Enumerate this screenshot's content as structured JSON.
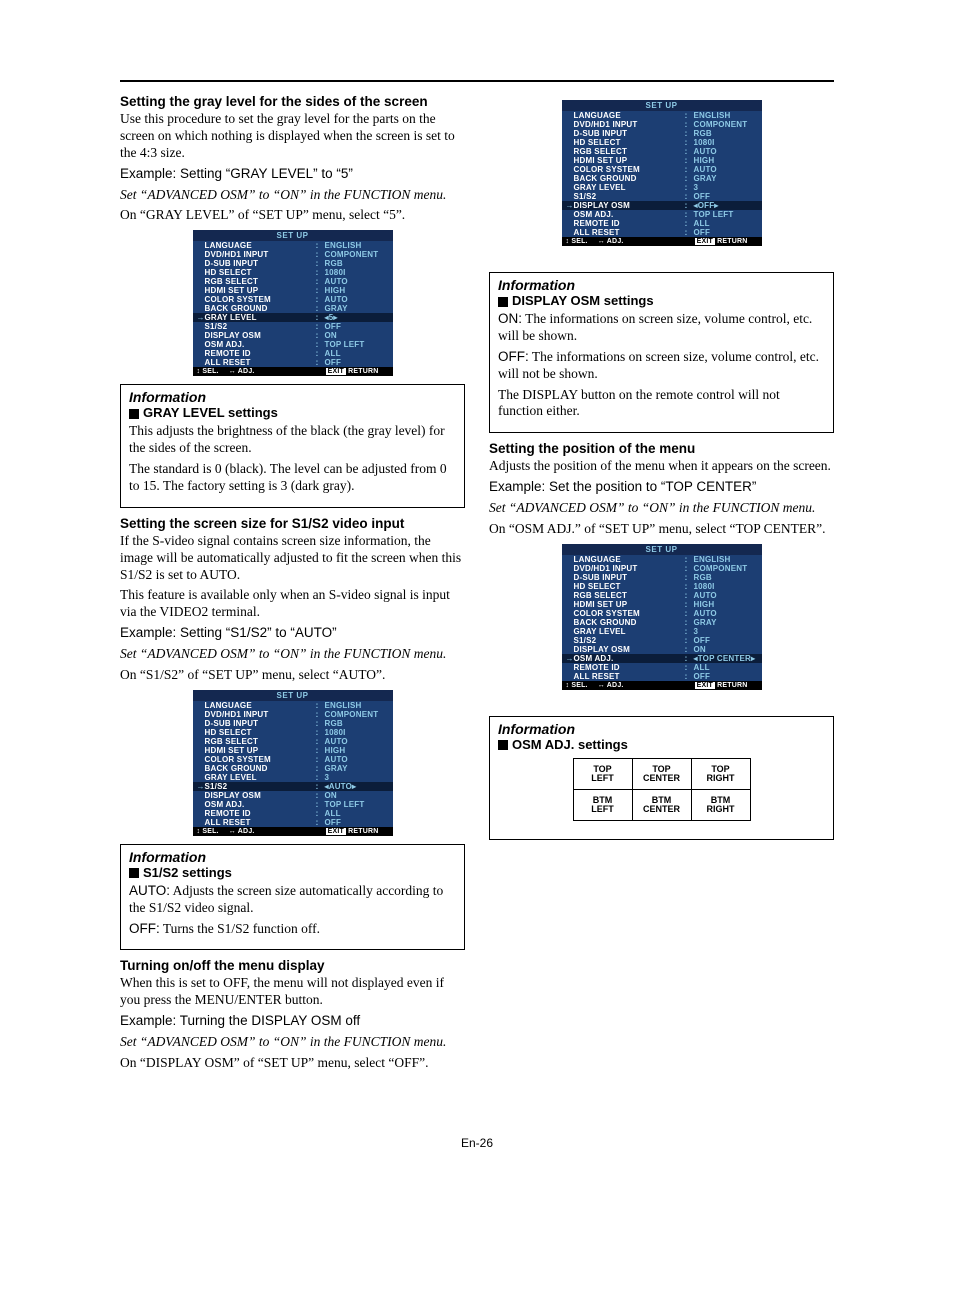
{
  "page_number": "En-26",
  "left": {
    "s1": {
      "title": "Setting the gray level for the sides of the screen",
      "p1": "Use this procedure to set the gray level for the parts on the screen on which nothing is displayed when the screen is set to the 4:3 size.",
      "ex": "Example: Setting “GRAY LEVEL” to “5”",
      "ital": "Set “ADVANCED OSM” to “ON” in the FUNCTION menu.",
      "p2": "On “GRAY LEVEL” of “SET UP” menu, select “5”."
    },
    "osd1": {
      "title": "SET UP",
      "rows": [
        {
          "l": "LANGUAGE",
          "v": "ENGLISH"
        },
        {
          "l": "DVD/HD1 INPUT",
          "v": "COMPONENT"
        },
        {
          "l": "D-SUB INPUT",
          "v": "RGB"
        },
        {
          "l": "HD SELECT",
          "v": "1080I"
        },
        {
          "l": "RGB SELECT",
          "v": "AUTO"
        },
        {
          "l": "HDMI SET UP",
          "v": "HIGH"
        },
        {
          "l": "COLOR SYSTEM",
          "v": "AUTO"
        },
        {
          "l": "BACK GROUND",
          "v": "GRAY"
        },
        {
          "l": "GRAY LEVEL",
          "v": "◂5▸",
          "sel": true
        },
        {
          "l": "S1/S2",
          "v": "OFF"
        },
        {
          "l": "DISPLAY OSM",
          "v": "ON"
        },
        {
          "l": "OSM ADJ.",
          "v": "TOP LEFT"
        },
        {
          "l": "REMOTE ID",
          "v": "ALL"
        },
        {
          "l": "ALL RESET",
          "v": "OFF"
        }
      ]
    },
    "info1": {
      "title": "Information",
      "sub": "GRAY LEVEL settings",
      "p1": "This adjusts the brightness of the black (the gray level) for the sides of the screen.",
      "p2": "The standard is 0 (black). The level can be adjusted from 0 to 15. The factory setting is 3 (dark gray)."
    },
    "s2": {
      "title": "Setting the screen size for S1/S2 video input",
      "p1": "If the S-video signal contains screen size information, the image will be automatically adjusted to fit the screen when this S1/S2 is set to AUTO.",
      "p2": "This feature is available only when an S-video signal is input via the VIDEO2 terminal.",
      "ex": "Example: Setting “S1/S2” to “AUTO”",
      "ital": "Set “ADVANCED OSM” to “ON” in the FUNCTION menu.",
      "p3": "On “S1/S2” of “SET UP” menu, select “AUTO”."
    },
    "osd2": {
      "title": "SET UP",
      "rows": [
        {
          "l": "LANGUAGE",
          "v": "ENGLISH"
        },
        {
          "l": "DVD/HD1 INPUT",
          "v": "COMPONENT"
        },
        {
          "l": "D-SUB INPUT",
          "v": "RGB"
        },
        {
          "l": "HD SELECT",
          "v": "1080I"
        },
        {
          "l": "RGB SELECT",
          "v": "AUTO"
        },
        {
          "l": "HDMI SET UP",
          "v": "HIGH"
        },
        {
          "l": "COLOR SYSTEM",
          "v": "AUTO"
        },
        {
          "l": "BACK GROUND",
          "v": "GRAY"
        },
        {
          "l": "GRAY LEVEL",
          "v": "3"
        },
        {
          "l": "S1/S2",
          "v": "◂AUTO▸",
          "sel": true
        },
        {
          "l": "DISPLAY OSM",
          "v": "ON"
        },
        {
          "l": "OSM ADJ.",
          "v": "TOP LEFT"
        },
        {
          "l": "REMOTE ID",
          "v": "ALL"
        },
        {
          "l": "ALL RESET",
          "v": "OFF"
        }
      ]
    },
    "info2": {
      "title": "Information",
      "sub": "S1/S2 settings",
      "auto_l": "AUTO:",
      "auto_t": " Adjusts the screen size automatically according to the S1/S2 video signal.",
      "off_l": "OFF:",
      "off_t": " Turns the S1/S2 function off."
    },
    "s3": {
      "title": "Turning on/off the menu display",
      "p1": "When this is set to OFF, the menu will not displayed even if you press the MENU/ENTER button.",
      "ex": "Example: Turning the DISPLAY OSM off",
      "ital": "Set “ADVANCED OSM” to “ON” in the FUNCTION menu.",
      "p2": "On “DISPLAY OSM” of “SET UP” menu, select “OFF”."
    }
  },
  "right": {
    "osd3": {
      "title": "SET UP",
      "rows": [
        {
          "l": "LANGUAGE",
          "v": "ENGLISH"
        },
        {
          "l": "DVD/HD1 INPUT",
          "v": "COMPONENT"
        },
        {
          "l": "D-SUB INPUT",
          "v": "RGB"
        },
        {
          "l": "HD SELECT",
          "v": "1080I"
        },
        {
          "l": "RGB SELECT",
          "v": "AUTO"
        },
        {
          "l": "HDMI SET UP",
          "v": "HIGH"
        },
        {
          "l": "COLOR SYSTEM",
          "v": "AUTO"
        },
        {
          "l": "BACK GROUND",
          "v": "GRAY"
        },
        {
          "l": "GRAY LEVEL",
          "v": "3"
        },
        {
          "l": "S1/S2",
          "v": "OFF"
        },
        {
          "l": "DISPLAY OSM",
          "v": "◂OFF▸",
          "sel": true
        },
        {
          "l": "OSM ADJ.",
          "v": "TOP LEFT"
        },
        {
          "l": "REMOTE ID",
          "v": "ALL"
        },
        {
          "l": "ALL RESET",
          "v": "OFF"
        }
      ]
    },
    "info3": {
      "title": "Information",
      "sub": "DISPLAY OSM settings",
      "on_l": "ON:",
      "on_t": " The informations on screen size, volume control, etc. will be shown.",
      "off_l": "OFF:",
      "off_t": " The informations on screen size, volume control, etc. will not be shown.",
      "p3": "The DISPLAY button on the remote control will not function either."
    },
    "s4": {
      "title": "Setting the position of the menu",
      "p1": "Adjusts the position of the menu when it appears on the screen.",
      "ex": "Example: Set the position to “TOP CENTER”",
      "ital": "Set “ADVANCED OSM” to “ON” in the FUNCTION menu.",
      "p2": "On “OSM ADJ.” of “SET UP” menu, select “TOP CENTER”."
    },
    "osd4": {
      "title": "SET UP",
      "rows": [
        {
          "l": "LANGUAGE",
          "v": "ENGLISH"
        },
        {
          "l": "DVD/HD1 INPUT",
          "v": "COMPONENT"
        },
        {
          "l": "D-SUB INPUT",
          "v": "RGB"
        },
        {
          "l": "HD SELECT",
          "v": "1080I"
        },
        {
          "l": "RGB SELECT",
          "v": "AUTO"
        },
        {
          "l": "HDMI SET UP",
          "v": "HIGH"
        },
        {
          "l": "COLOR SYSTEM",
          "v": "AUTO"
        },
        {
          "l": "BACK GROUND",
          "v": "GRAY"
        },
        {
          "l": "GRAY LEVEL",
          "v": "3"
        },
        {
          "l": "S1/S2",
          "v": "OFF"
        },
        {
          "l": "DISPLAY OSM",
          "v": "ON"
        },
        {
          "l": "OSM ADJ.",
          "v": "◂TOP CENTER▸",
          "sel": true
        },
        {
          "l": "REMOTE ID",
          "v": "ALL"
        },
        {
          "l": "ALL RESET",
          "v": "OFF"
        }
      ]
    },
    "info4": {
      "title": "Information",
      "sub": "OSM ADJ. settings",
      "grid": [
        [
          "TOP",
          "LEFT"
        ],
        [
          "TOP",
          "CENTER"
        ],
        [
          "TOP",
          "RIGHT"
        ],
        [
          "BTM",
          "LEFT"
        ],
        [
          "BTM",
          "CENTER"
        ],
        [
          "BTM",
          "RIGHT"
        ]
      ]
    }
  },
  "footer": {
    "sel": "↕ SEL.",
    "adj": "↔ ADJ.",
    "exit": "RETURN",
    "exit_btn": "EXIT"
  }
}
